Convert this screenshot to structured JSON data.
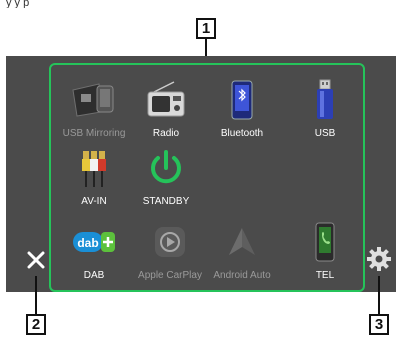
{
  "top_text": "y y p",
  "callouts": {
    "one": "1",
    "two": "2",
    "three": "3"
  },
  "sources": [
    {
      "label": "USB Mirroring",
      "icon": "usb-mirroring-icon",
      "enabled": false
    },
    {
      "label": "Radio",
      "icon": "radio-icon",
      "enabled": true
    },
    {
      "label": "Bluetooth",
      "icon": "bluetooth-phone-icon",
      "enabled": true
    },
    {
      "label": "USB",
      "icon": "usb-drive-icon",
      "enabled": true
    },
    {
      "label": "AV-IN",
      "icon": "av-cable-icon",
      "enabled": true
    },
    {
      "label": "STANDBY",
      "icon": "power-icon",
      "enabled": true
    },
    {
      "label": "DAB",
      "icon": "dab-logo-icon",
      "enabled": true
    },
    {
      "label": "Apple CarPlay",
      "icon": "carplay-icon",
      "enabled": false
    },
    {
      "label": "Android Auto",
      "icon": "android-auto-icon",
      "enabled": false
    },
    {
      "label": "TEL",
      "icon": "phone-icon",
      "enabled": true
    }
  ],
  "dab_logo_text": "dab",
  "colors": {
    "accent": "#25c35a",
    "screen": "#4b4b4b",
    "usb_blue": "#2c3fb5"
  }
}
